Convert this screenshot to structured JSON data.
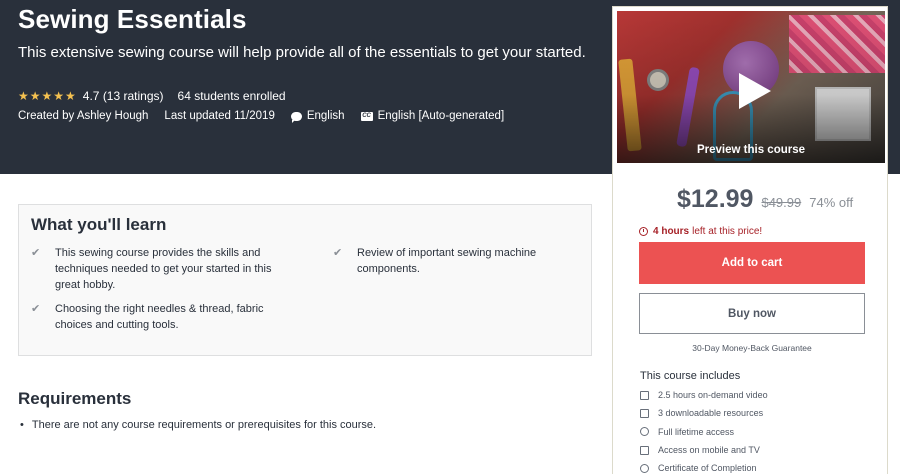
{
  "header": {
    "title": "Sewing Essentials",
    "subtitle": "This extensive sewing course will help provide all of the essentials to get your started.",
    "stars": "★★★★★",
    "rating": "4.7 (13 ratings)",
    "students": "64 students enrolled",
    "created_by": "Created by Ashley Hough",
    "last_updated": "Last updated 11/2019",
    "language": "English",
    "captions": "English [Auto-generated]",
    "captions_icon_text": "CC"
  },
  "sidebar": {
    "preview_label": "Preview this course",
    "price_current": "$12.99",
    "price_original": "$49.99",
    "discount": "74% off",
    "timer_bold": "4 hours",
    "timer_rest": "left at this price!",
    "add_to_cart": "Add to cart",
    "buy_now": "Buy now",
    "guarantee": "30-Day Money-Back Guarantee",
    "includes_title": "This course includes",
    "includes": [
      {
        "icon": "video-icon",
        "text": "2.5 hours on-demand video"
      },
      {
        "icon": "file-icon",
        "text": "3 downloadable resources"
      },
      {
        "icon": "infinity-icon",
        "text": "Full lifetime access"
      },
      {
        "icon": "mobile-icon",
        "text": "Access on mobile and TV"
      },
      {
        "icon": "certificate-icon",
        "text": "Certificate of Completion"
      }
    ]
  },
  "learn": {
    "title": "What you'll learn",
    "items": [
      "This sewing course provides the skills and techniques needed to get your started in this great hobby.",
      "Review of important sewing machine components.",
      "Choosing the right needles & thread, fabric choices and cutting tools."
    ]
  },
  "requirements": {
    "title": "Requirements",
    "items": [
      "There are not any course requirements or prerequisites for this course."
    ]
  },
  "colors": {
    "header_bg": "#29303b",
    "star": "#f4c150",
    "cart_button": "#ec5252",
    "timer": "#a72228"
  }
}
